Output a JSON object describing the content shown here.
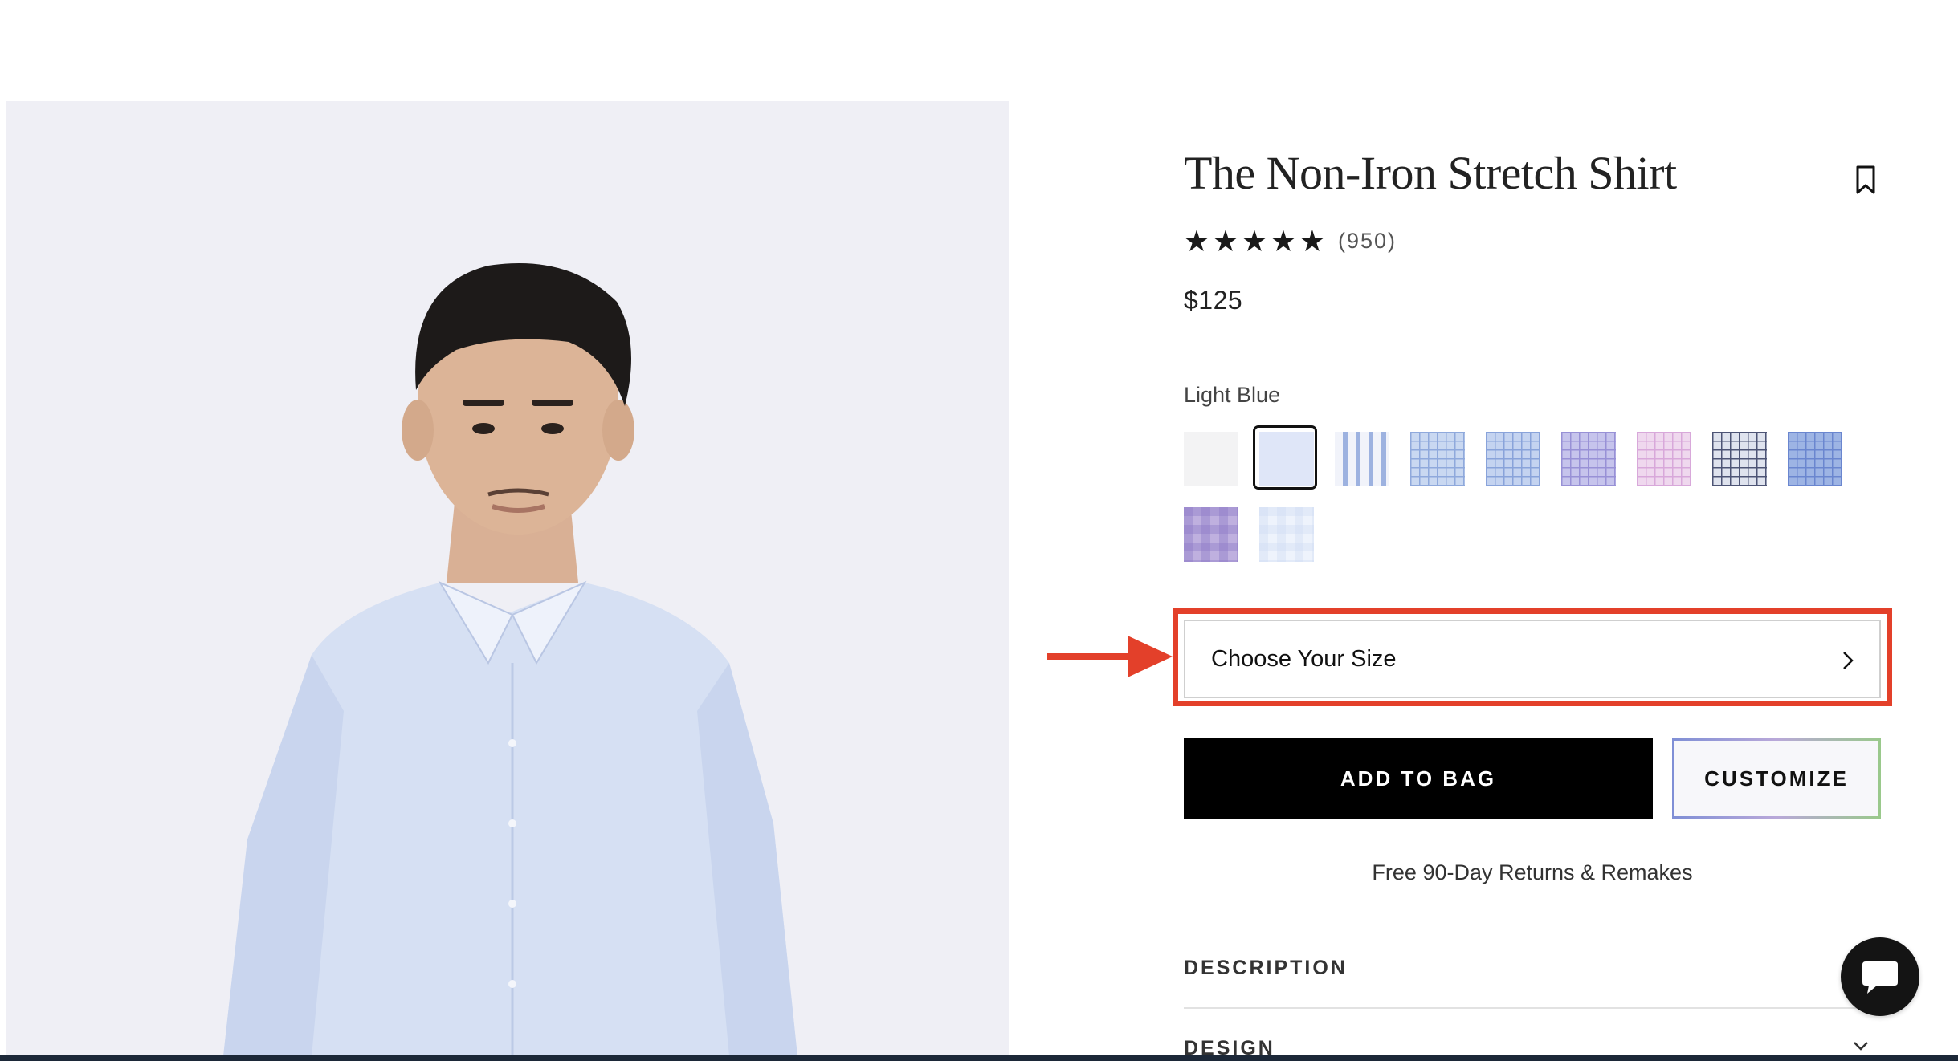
{
  "product": {
    "title": "The Non-Iron Stretch Shirt",
    "rating_stars": [
      "★",
      "★",
      "★",
      "★",
      "★"
    ],
    "rating_value": 5,
    "review_count": "(950)",
    "price": "$125",
    "selected_color": "Light Blue"
  },
  "swatches": [
    {
      "name": "swatch-white",
      "pattern": "solid",
      "c1": "#f3f3f4",
      "c2": "#f3f3f4",
      "selected": false
    },
    {
      "name": "swatch-light-blue",
      "pattern": "solid",
      "c1": "#dfe6f8",
      "c2": "#dfe6f8",
      "selected": true
    },
    {
      "name": "swatch-blue-stripe",
      "pattern": "stripe",
      "c1": "#f1f3fa",
      "c2": "#9db2e0",
      "selected": false
    },
    {
      "name": "swatch-blue-check",
      "pattern": "check",
      "c1": "#c9d8f1",
      "c2": "#8fa9dc",
      "selected": false
    },
    {
      "name": "swatch-blue-grid",
      "pattern": "check",
      "c1": "#c4d3f0",
      "c2": "#89a3da",
      "selected": false
    },
    {
      "name": "swatch-purple-check",
      "pattern": "check",
      "c1": "#c6c4ec",
      "c2": "#9891d6",
      "selected": false
    },
    {
      "name": "swatch-pink-check",
      "pattern": "check",
      "c1": "#efd8ee",
      "c2": "#d8a8da",
      "selected": false
    },
    {
      "name": "swatch-navy-check",
      "pattern": "check",
      "c1": "#dfe3ee",
      "c2": "#4d5475",
      "selected": false
    },
    {
      "name": "swatch-blue-windowpane",
      "pattern": "check",
      "c1": "#9db4e4",
      "c2": "#6a86cf",
      "selected": false
    },
    {
      "name": "swatch-lavender-gingham",
      "pattern": "gingham",
      "c1": "#bfb0df",
      "c2": "#8a77c6",
      "selected": false
    },
    {
      "name": "swatch-light-blue-gingham",
      "pattern": "gingham",
      "c1": "#eef3fc",
      "c2": "#cfdcf4",
      "selected": false
    }
  ],
  "size_select": {
    "label": "Choose Your Size"
  },
  "buttons": {
    "add_to_bag": "ADD TO BAG",
    "customize": "CUSTOMIZE"
  },
  "returns_note": "Free 90-Day Returns & Remakes",
  "accordion": {
    "description": "DESCRIPTION",
    "design": "DESIGN"
  },
  "icons": {
    "save": "bookmark-icon",
    "size_chevron": "chevron-right-icon",
    "design_chevron": "chevron-down-icon",
    "chat": "chat-bubble-icon",
    "annotation": "arrow-right-icon"
  },
  "colors": {
    "highlight": "#e3402a",
    "primary_button": "#000000",
    "photo_background": "#efeff5"
  }
}
